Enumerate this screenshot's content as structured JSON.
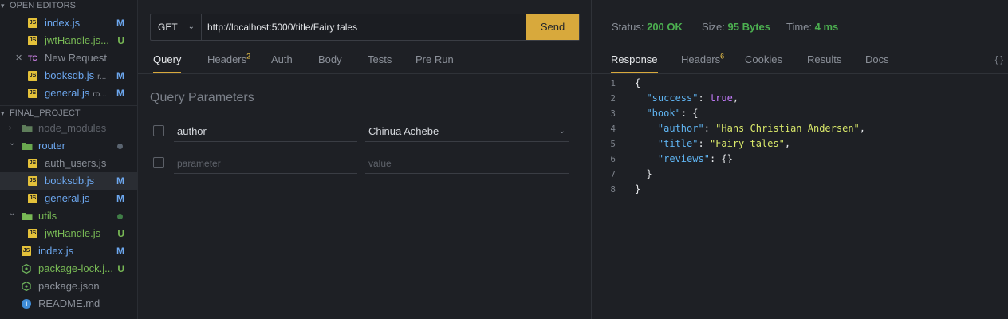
{
  "sidebar": {
    "open_editors_title": "OPEN EDITORS",
    "open_editors": [
      {
        "icon": "js",
        "name": "index.js",
        "desc": "",
        "badge": "M",
        "badge_color": "#6da8f0",
        "name_color": "#6da8f0"
      },
      {
        "icon": "js",
        "name": "jwtHandle.js...",
        "desc": "",
        "badge": "U",
        "badge_color": "#78b955",
        "name_color": "#78b955"
      },
      {
        "icon": "tc",
        "name": "New Request",
        "desc": "",
        "badge": "",
        "badge_color": "",
        "name_color": "#8b9099"
      },
      {
        "icon": "js",
        "name": "booksdb.js",
        "desc": "r...",
        "badge": "M",
        "badge_color": "#6da8f0",
        "name_color": "#6da8f0"
      },
      {
        "icon": "js",
        "name": "general.js",
        "desc": "ro...",
        "badge": "M",
        "badge_color": "#6da8f0",
        "name_color": "#6da8f0"
      }
    ],
    "project_title": "FINAL_PROJECT",
    "tree": [
      {
        "icon": "folder-node",
        "name": "node_modules",
        "badge": "",
        "name_color": "#5e626a"
      },
      {
        "icon": "folder-router",
        "name": "router",
        "badge": "dot",
        "name_color": "#6da8f0",
        "dot_color": "#5a6470"
      },
      {
        "icon": "js",
        "name": "auth_users.js",
        "badge": "",
        "name_color": "#8b9099"
      },
      {
        "icon": "js",
        "name": "booksdb.js",
        "badge": "M",
        "badge_color": "#6da8f0",
        "name_color": "#6da8f0"
      },
      {
        "icon": "js",
        "name": "general.js",
        "badge": "M",
        "badge_color": "#6da8f0",
        "name_color": "#6da8f0"
      },
      {
        "icon": "folder-utils",
        "name": "utils",
        "badge": "dot",
        "name_color": "#78b955",
        "dot_color": "#3f7d46"
      },
      {
        "icon": "js",
        "name": "jwtHandle.js",
        "badge": "U",
        "badge_color": "#78b955",
        "name_color": "#78b955"
      },
      {
        "icon": "js",
        "name": "index.js",
        "badge": "M",
        "badge_color": "#6da8f0",
        "name_color": "#6da8f0"
      },
      {
        "icon": "node",
        "name": "package-lock.j...",
        "badge": "U",
        "badge_color": "#78b955",
        "name_color": "#78b955"
      },
      {
        "icon": "node",
        "name": "package.json",
        "badge": "",
        "name_color": "#8b9099"
      },
      {
        "icon": "info",
        "name": "README.md",
        "badge": "",
        "name_color": "#8b9099"
      }
    ]
  },
  "request": {
    "method": "GET",
    "url": "http://localhost:5000/title/Fairy tales",
    "send_label": "Send",
    "tabs": [
      {
        "label": "Query",
        "count": "",
        "active": true
      },
      {
        "label": "Headers",
        "count": "2",
        "active": false
      },
      {
        "label": "Auth",
        "count": "",
        "active": false
      },
      {
        "label": "Body",
        "count": "",
        "active": false
      },
      {
        "label": "Tests",
        "count": "",
        "active": false
      },
      {
        "label": "Pre Run",
        "count": "",
        "active": false
      }
    ],
    "query_title": "Query Parameters",
    "params": [
      {
        "name": "author",
        "value": "Chinua Achebe"
      }
    ],
    "param_placeholder": "parameter",
    "value_placeholder": "value"
  },
  "response": {
    "status_label": "Status:",
    "status_value": "200 OK",
    "size_label": "Size:",
    "size_value": "95 Bytes",
    "time_label": "Time:",
    "time_value": "4 ms",
    "tabs": [
      {
        "label": "Response",
        "count": "",
        "active": true
      },
      {
        "label": "Headers",
        "count": "6",
        "active": false
      },
      {
        "label": "Cookies",
        "count": "",
        "active": false
      },
      {
        "label": "Results",
        "count": "",
        "active": false
      },
      {
        "label": "Docs",
        "count": "",
        "active": false
      }
    ],
    "braces_label": "{ }",
    "code_lines": [
      [
        {
          "t": "{",
          "c": "p"
        }
      ],
      [
        {
          "t": "  ",
          "c": "p"
        },
        {
          "t": "\"success\"",
          "c": "k"
        },
        {
          "t": ": ",
          "c": "p"
        },
        {
          "t": "true",
          "c": "b"
        },
        {
          "t": ",",
          "c": "p"
        }
      ],
      [
        {
          "t": "  ",
          "c": "p"
        },
        {
          "t": "\"book\"",
          "c": "k"
        },
        {
          "t": ": {",
          "c": "p"
        }
      ],
      [
        {
          "t": "    ",
          "c": "p"
        },
        {
          "t": "\"author\"",
          "c": "k"
        },
        {
          "t": ": ",
          "c": "p"
        },
        {
          "t": "\"Hans Christian Andersen\"",
          "c": "s"
        },
        {
          "t": ",",
          "c": "p"
        }
      ],
      [
        {
          "t": "    ",
          "c": "p"
        },
        {
          "t": "\"title\"",
          "c": "k"
        },
        {
          "t": ": ",
          "c": "p"
        },
        {
          "t": "\"Fairy tales\"",
          "c": "s"
        },
        {
          "t": ",",
          "c": "p"
        }
      ],
      [
        {
          "t": "    ",
          "c": "p"
        },
        {
          "t": "\"reviews\"",
          "c": "k"
        },
        {
          "t": ": {}",
          "c": "p"
        }
      ],
      [
        {
          "t": "  }",
          "c": "p"
        }
      ],
      [
        {
          "t": "}",
          "c": "p"
        }
      ]
    ]
  }
}
